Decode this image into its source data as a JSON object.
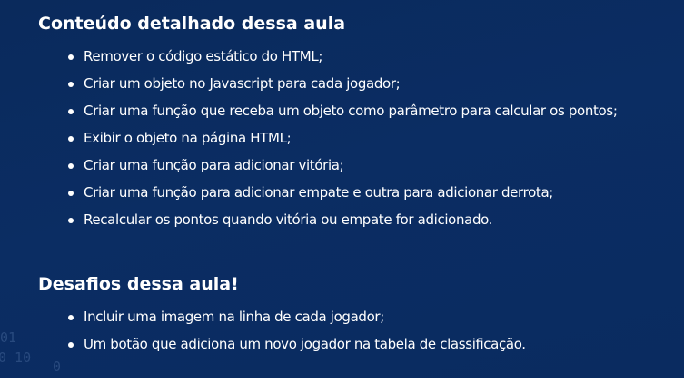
{
  "content_section": {
    "title": "Conteúdo detalhado dessa aula",
    "items": [
      "Remover o código estático do HTML;",
      "Criar um objeto no Javascript para cada jogador;",
      "Criar uma função que receba um objeto como parâmetro para calcular os pontos;",
      "Exibir o objeto na página HTML;",
      "Criar uma função para adicionar vitória;",
      "Criar uma função para adicionar empate e outra para adicionar derrota;",
      "Recalcular os pontos quando vitória ou empate for adicionado."
    ]
  },
  "challenges_section": {
    "title": "Desafios dessa aula!",
    "items": [
      "Incluir uma imagem na linha de cada jogador;",
      "Um botão que adiciona um novo jogador na tabela de classificação."
    ]
  },
  "background_code": {
    "line1": "01",
    "line2": "0 10",
    "line3": "0"
  },
  "colors": {
    "background": "#0b2d63",
    "text": "#ffffff"
  }
}
